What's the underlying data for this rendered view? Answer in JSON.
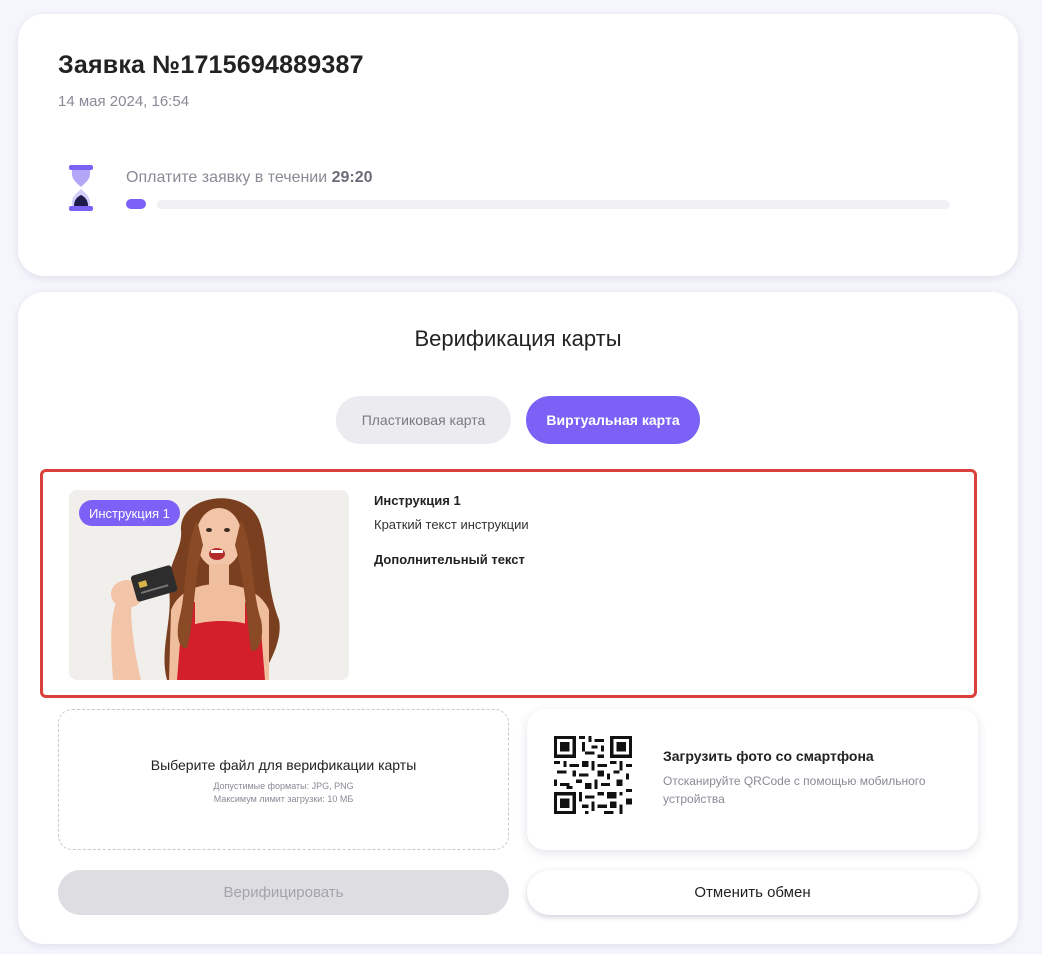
{
  "order": {
    "title": "Заявка №1715694889387",
    "date": "14 мая 2024, 16:54",
    "timer_label": "Оплатите заявку в течении ",
    "timer_value": "29:20",
    "progress_fraction": 0.02
  },
  "verification": {
    "title": "Верификация карты",
    "tabs": [
      {
        "label": "Пластиковая карта",
        "active": false
      },
      {
        "label": "Виртуальная карта",
        "active": true
      }
    ],
    "instruction": {
      "badge": "Инструкция 1",
      "heading": "Инструкция 1",
      "text": "Краткий текст инструкции",
      "extra": "Дополнительный текст"
    },
    "upload": {
      "title": "Выберите файл для верификации карты",
      "formats": "Допустимые форматы: JPG, PNG",
      "limit": "Максимум лимит загрузки: 10 МБ"
    },
    "qr": {
      "title": "Загрузить фото со смартфона",
      "description": "Отсканируйте QRCode с помощью мобильного устройства"
    },
    "buttons": {
      "verify": "Верифицировать",
      "cancel": "Отменить обмен"
    }
  },
  "colors": {
    "accent": "#7b61f5",
    "highlight_border": "#d9413a",
    "page_bg": "#f5f5fc"
  },
  "icons": {
    "timer": "hourglass-icon",
    "qr": "qr-code-icon"
  }
}
